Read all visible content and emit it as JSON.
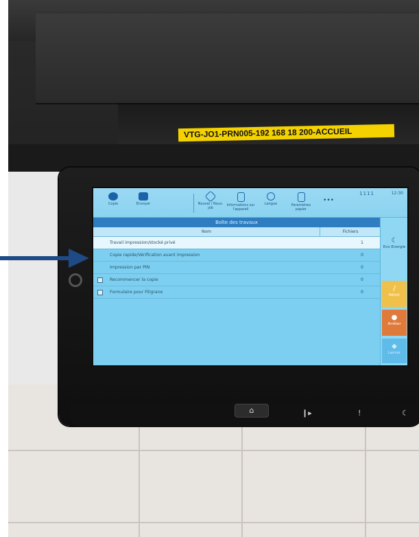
{
  "sticker_label": "VTG-JO1-PRN005-192 168 18 200-ACCUEIL",
  "status": {
    "clock": "12:30",
    "dots": "1111"
  },
  "top_buttons": [
    {
      "name": "copy",
      "label": "Copie",
      "icon": "copy-icon"
    },
    {
      "name": "send",
      "label": "Envoyer",
      "icon": "send-icon"
    },
    {
      "name": "new-job",
      "label": "Nouvel / Nouv. job",
      "icon": "new-job-icon"
    },
    {
      "name": "info",
      "label": "Informations sur l'appareil",
      "icon": "info-icon"
    },
    {
      "name": "language",
      "label": "Langue",
      "icon": "globe-icon"
    },
    {
      "name": "paper",
      "label": "Paramètres papier",
      "icon": "paper-icon"
    },
    {
      "name": "more",
      "label": "•••",
      "icon": "more-icon"
    }
  ],
  "panel": {
    "title": "Boîte des travaux",
    "col_name": "Nom",
    "col_files": "Fichiers"
  },
  "rows": [
    {
      "name": "Travail impression/stocké privé",
      "count": "1",
      "icon": ""
    },
    {
      "name": "Copie rapide/Vérification avant impression",
      "count": "0",
      "icon": ""
    },
    {
      "name": "Impression par PIN",
      "count": "0",
      "icon": ""
    },
    {
      "name": "Recommencer la copie",
      "count": "0",
      "icon": "recopy-icon"
    },
    {
      "name": "Formulaire pour Filigrane",
      "count": "0",
      "icon": "form-icon"
    }
  ],
  "side_buttons": [
    {
      "name": "energy-saver",
      "label": "Eco Energie",
      "glyph": "☾",
      "color": "#8fd7f3"
    },
    {
      "name": "reset",
      "label": "Réinit",
      "glyph": "∕",
      "color": "#f0c14a"
    },
    {
      "name": "stop",
      "label": "Arrêter",
      "glyph": "●",
      "color": "#e07a3a"
    },
    {
      "name": "start",
      "label": "Lancer",
      "glyph": "◆",
      "color": "#5fbce9"
    }
  ],
  "hardware": {
    "home_label": "⌂",
    "key_1": "❙▸",
    "key_2": "!",
    "key_3": "☾"
  },
  "colors": {
    "screen_bg": "#7ccff0",
    "accent_blue": "#2f7dc1",
    "arrow": "#1e4a86",
    "sticker": "#f4d200"
  }
}
